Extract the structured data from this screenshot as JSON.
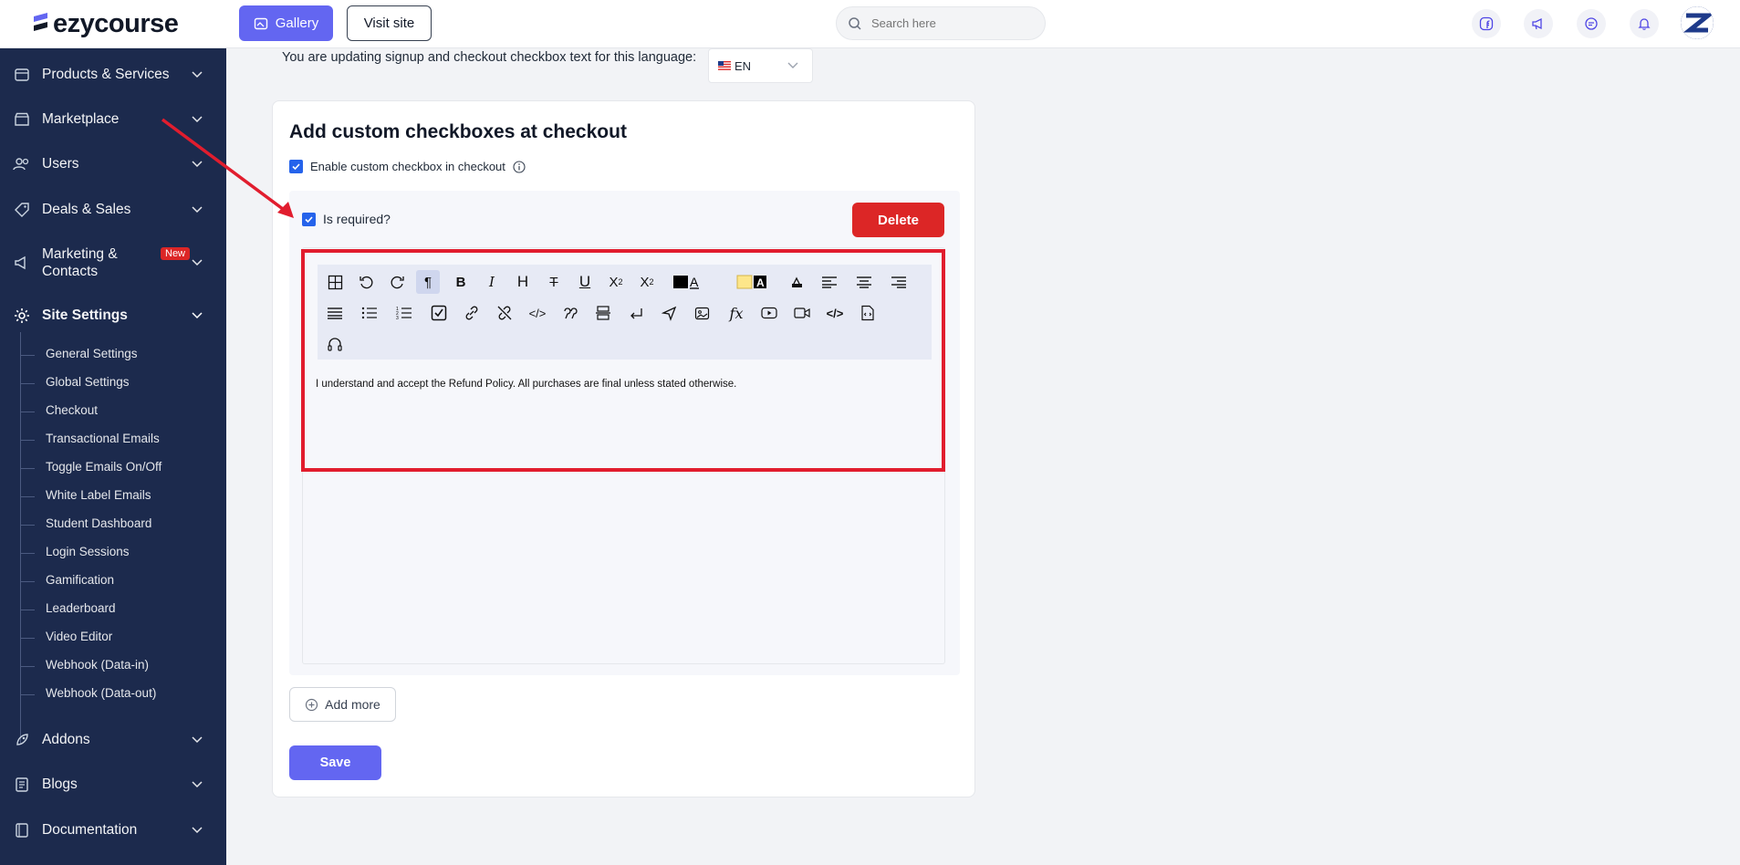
{
  "brand": {
    "name": "ezycourse"
  },
  "topbar": {
    "gallery_label": "Gallery",
    "visit_site_label": "Visit site",
    "search_placeholder": "Search here"
  },
  "sidebar": {
    "items": [
      {
        "label": "Products & Services"
      },
      {
        "label": "Marketplace"
      },
      {
        "label": "Users"
      },
      {
        "label": "Deals & Sales"
      },
      {
        "label": "Marketing &",
        "label2": "Contacts",
        "badge": "New"
      },
      {
        "label": "Site Settings"
      },
      {
        "label": "Addons"
      },
      {
        "label": "Blogs"
      },
      {
        "label": "Documentation"
      }
    ],
    "subitems": [
      "General Settings",
      "Global Settings",
      "Checkout",
      "Transactional Emails",
      "Toggle Emails On/Off",
      "White Label Emails",
      "Student Dashboard",
      "Login Sessions",
      "Gamification",
      "Leaderboard",
      "Video Editor",
      "Webhook (Data-in)",
      "Webhook (Data-out)"
    ]
  },
  "main": {
    "language_label": "You are updating signup and checkout checkbox text for this language:",
    "language_value": "EN",
    "card_title": "Add custom checkboxes at checkout",
    "enable_label": "Enable custom checkbox in checkout",
    "enable_checked": true,
    "is_required_label": "Is required?",
    "is_required_checked": true,
    "delete_label": "Delete",
    "editor_text": "I understand and accept the Refund Policy. All purchases are final unless stated otherwise.",
    "add_more_label": "Add more",
    "save_label": "Save"
  },
  "colors": {
    "accent": "#6366f1",
    "sidebar_bg": "#1c2a4d",
    "danger": "#dc2626",
    "annotation": "#e11d2e"
  }
}
